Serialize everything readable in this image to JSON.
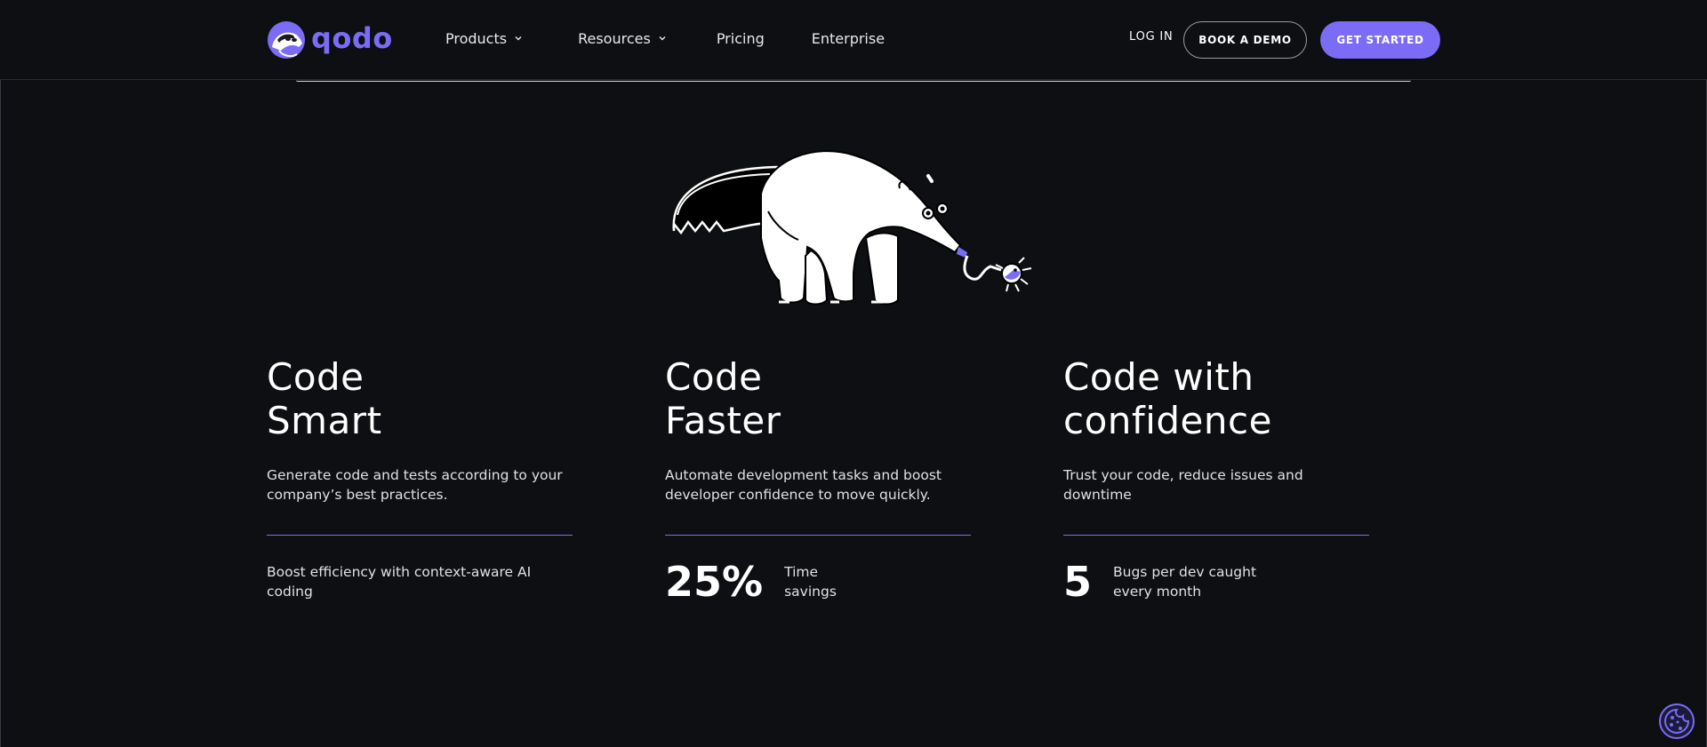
{
  "nav": {
    "logo_text": "qodo",
    "items": [
      {
        "label": "Products",
        "has_dropdown": true
      },
      {
        "label": "Resources",
        "has_dropdown": true
      },
      {
        "label": "Pricing",
        "has_dropdown": false
      },
      {
        "label": "Enterprise",
        "has_dropdown": false
      }
    ],
    "login_label": "LOG IN",
    "demo_label": "BOOK A DEMO",
    "start_label": "GET STARTED"
  },
  "illustration": {
    "icon": "anteater-illustration"
  },
  "features": [
    {
      "title_line1": "Code",
      "title_line2": "Smart",
      "description": "Generate code and tests according to your company’s best practices.",
      "stat_value": "",
      "stat_label": "Boost efficiency with context-aware AI coding"
    },
    {
      "title_line1": "Code",
      "title_line2": "Faster",
      "description": "Automate development tasks and boost developer confidence to move quickly.",
      "stat_value": "25%",
      "stat_label": "Time savings"
    },
    {
      "title_line1": "Code with",
      "title_line2": "confidence",
      "description": "Trust your code, reduce issues and downtime",
      "stat_value": "5",
      "stat_label": "Bugs per dev caught every month"
    }
  ],
  "colors": {
    "accent": "#7b6cf6",
    "background": "#0e0f12",
    "text": "#ffffff"
  },
  "cookie": {
    "icon": "cookie-icon"
  }
}
